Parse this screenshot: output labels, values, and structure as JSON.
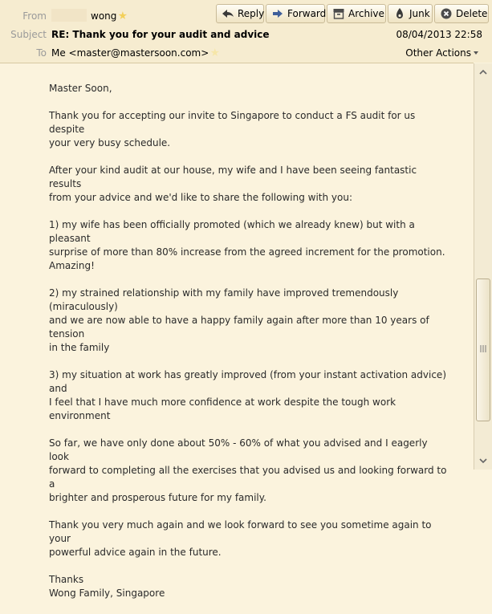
{
  "header": {
    "from_label": "From",
    "from_name": "wong",
    "subject_label": "Subject",
    "subject": "RE: Thank you for your audit and advice",
    "to_label": "To",
    "to_value": "Me <master@mastersoon.com>",
    "date": "08/04/2013 22:58",
    "other_actions": "Other Actions"
  },
  "toolbar": {
    "reply": "Reply",
    "forward": "Forward",
    "archive": "Archive",
    "junk": "Junk",
    "delete": "Delete"
  },
  "message": {
    "paragraphs": [
      "Master Soon,",
      "Thank you for accepting our invite to Singapore to conduct a FS audit for us despite\nyour very busy schedule.",
      "After your kind audit at our house, my wife and I have been seeing fantastic results\nfrom your advice and we'd like to share the following with you:",
      "1) my wife has been officially promoted (which we already knew) but with a pleasant\nsurprise of more than 80% increase from the agreed increment for the promotion.\nAmazing!",
      "2) my strained relationship with my family have improved tremendously (miraculously)\nand we are now able to have a happy family again after more than 10 years of tension\nin the family",
      "3) my situation at work has greatly improved (from your instant activation advice) and\nI feel that I have much more confidence at work despite the tough work environment",
      "So far, we have only done about 50% - 60% of what you advised and I eagerly look\nforward to completing all the exercises that you advised us and looking forward to a\nbrighter and prosperous future for my family.",
      "Thank you very much again and we look forward to see you sometime again to your\npowerful advice again in the future.",
      "Thanks\nWong Family, Singapore"
    ]
  },
  "colors": {
    "background": "#fbf3dd",
    "header_background": "#f6ecd0",
    "star": "#f3d05a",
    "forward_arrow": "#3f5f9a"
  }
}
